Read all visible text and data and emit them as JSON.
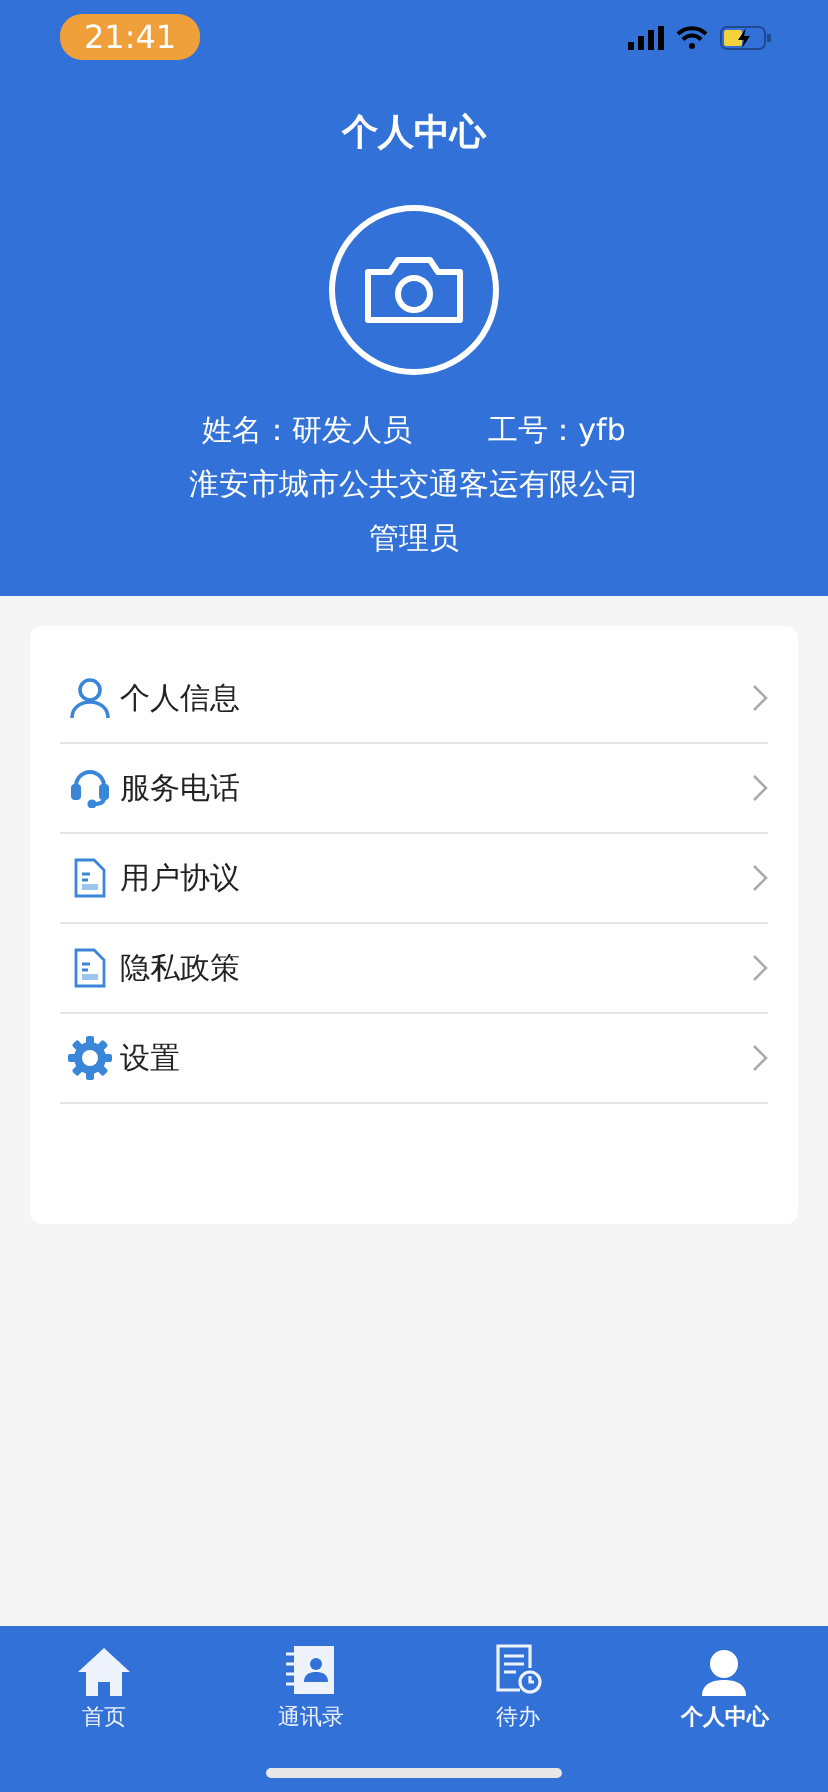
{
  "status_bar": {
    "time": "21:41"
  },
  "header": {
    "title": "个人中心",
    "name_label": "姓名：研发人员",
    "id_label": "工号：yfb",
    "company": "淮安市城市公共交通客运有限公司",
    "role": "管理员"
  },
  "menu": [
    {
      "kind": "person",
      "label": "个人信息"
    },
    {
      "kind": "headset",
      "label": "服务电话"
    },
    {
      "kind": "document",
      "label": "用户协议"
    },
    {
      "kind": "document",
      "label": "隐私政策"
    },
    {
      "kind": "gear",
      "label": "设置"
    }
  ],
  "tab_bar": [
    {
      "kind": "home",
      "label": "首页",
      "selected": false
    },
    {
      "kind": "contacts",
      "label": "通讯录",
      "selected": false
    },
    {
      "kind": "todo",
      "label": "待办",
      "selected": false
    },
    {
      "kind": "profile",
      "label": "个人中心",
      "selected": true
    }
  ]
}
